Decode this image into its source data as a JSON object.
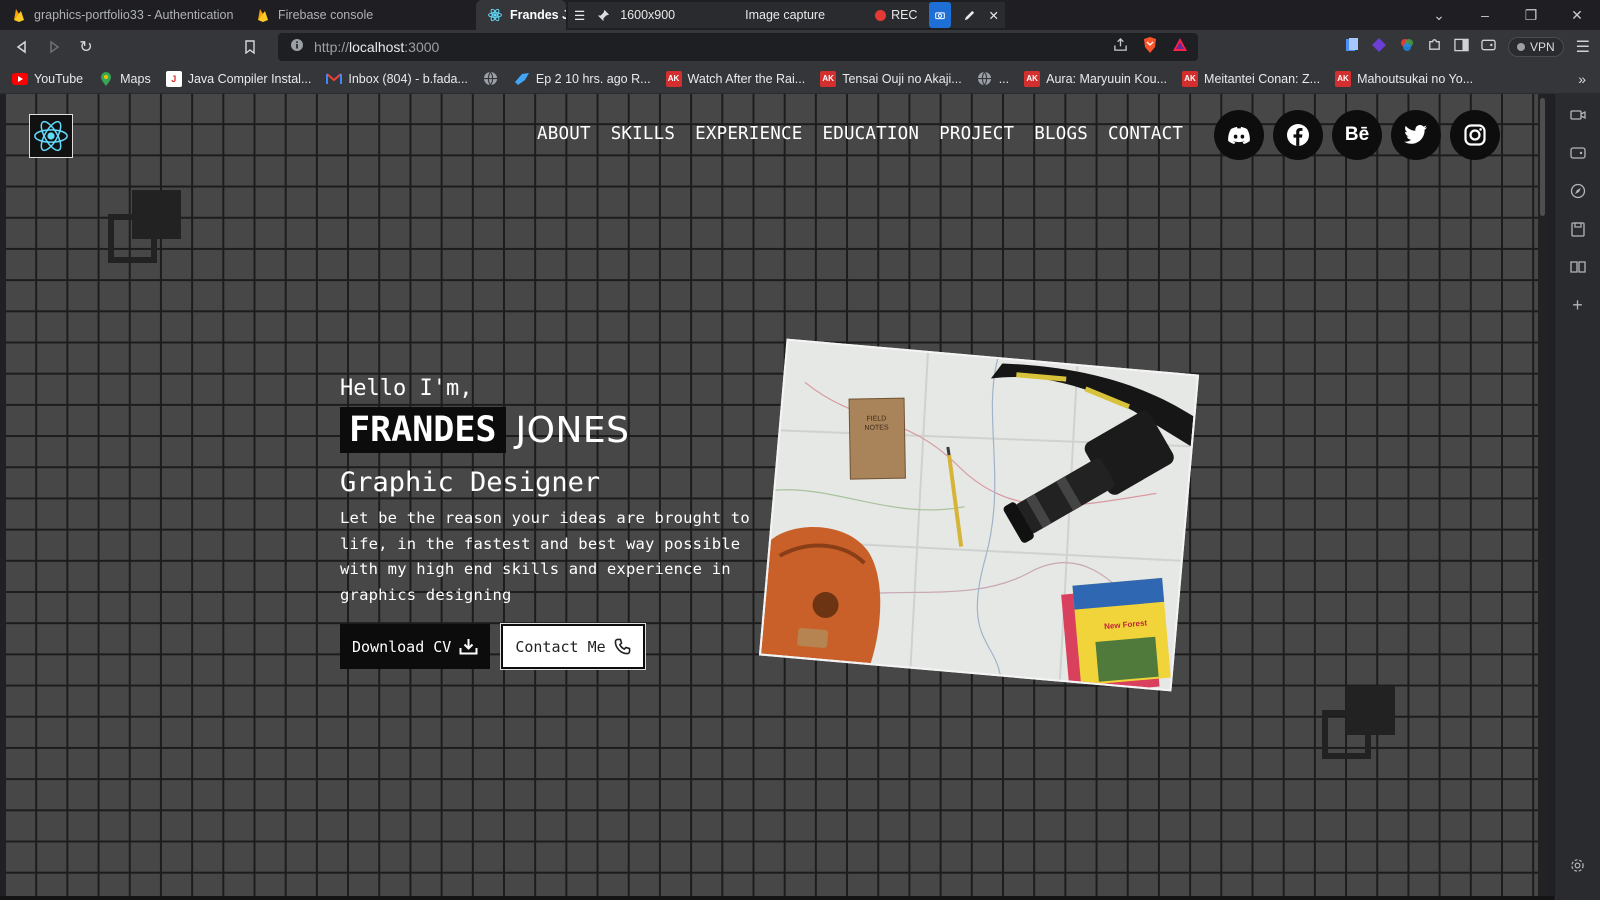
{
  "tabs": [
    {
      "title": "graphics-portfolio33 - Authentication",
      "icon": "firebase-icon"
    },
    {
      "title": "Firebase console",
      "icon": "firebase-icon"
    },
    {
      "title": "Frandes J.",
      "icon": "react-icon",
      "active": true
    }
  ],
  "capture": {
    "resolution": "1600x900",
    "label": "Image capture",
    "rec": "REC"
  },
  "address": {
    "scheme": "http://",
    "host": "localhost",
    "port": ":3000"
  },
  "extensions": {
    "vpn": "VPN"
  },
  "bookmarks": [
    {
      "label": "YouTube",
      "icon": "youtube-icon"
    },
    {
      "label": "Maps",
      "icon": "maps-icon"
    },
    {
      "label": "Java Compiler Instal...",
      "icon": "java-icon"
    },
    {
      "label": "Inbox (804) - b.fada...",
      "icon": "gmail-icon"
    },
    {
      "label": "",
      "icon": "globe-icon"
    },
    {
      "label": "Ep 2 10 hrs. ago R...",
      "icon": "bird-icon"
    },
    {
      "label": "Watch After the Rai...",
      "icon": "ak-icon"
    },
    {
      "label": "Tensai Ouji no Akaji...",
      "icon": "ak-icon"
    },
    {
      "label": "...",
      "icon": "globe-icon"
    },
    {
      "label": "Aura: Maryuuin Kou...",
      "icon": "ak-icon"
    },
    {
      "label": "Meitantei Conan: Z...",
      "icon": "ak-icon"
    },
    {
      "label": "Mahoutsukai no Yo...",
      "icon": "ak-icon"
    }
  ],
  "site": {
    "nav": [
      "ABOUT",
      "SKILLS",
      "EXPERIENCE",
      "EDUCATION",
      "PROJECT",
      "BLOGS",
      "CONTACT"
    ],
    "socials": [
      {
        "name": "discord",
        "glyph": ""
      },
      {
        "name": "facebook",
        "glyph": ""
      },
      {
        "name": "behance",
        "glyph": "Bē"
      },
      {
        "name": "twitter",
        "glyph": ""
      },
      {
        "name": "instagram",
        "glyph": ""
      }
    ],
    "hero": {
      "greeting": "Hello I'm,",
      "first_name": "FRANDES",
      "last_name": "JONES",
      "role": "Graphic Designer",
      "bio": "Let be the reason your ideas are brought to life, in the fastest and best way possible with my high end skills and experience in graphics designing",
      "download_label": "Download CV",
      "contact_label": "Contact Me"
    },
    "colors": {
      "grid_line": "#1c1c1c",
      "tile": "#474747",
      "button_dark": "#0c0c0c"
    }
  }
}
